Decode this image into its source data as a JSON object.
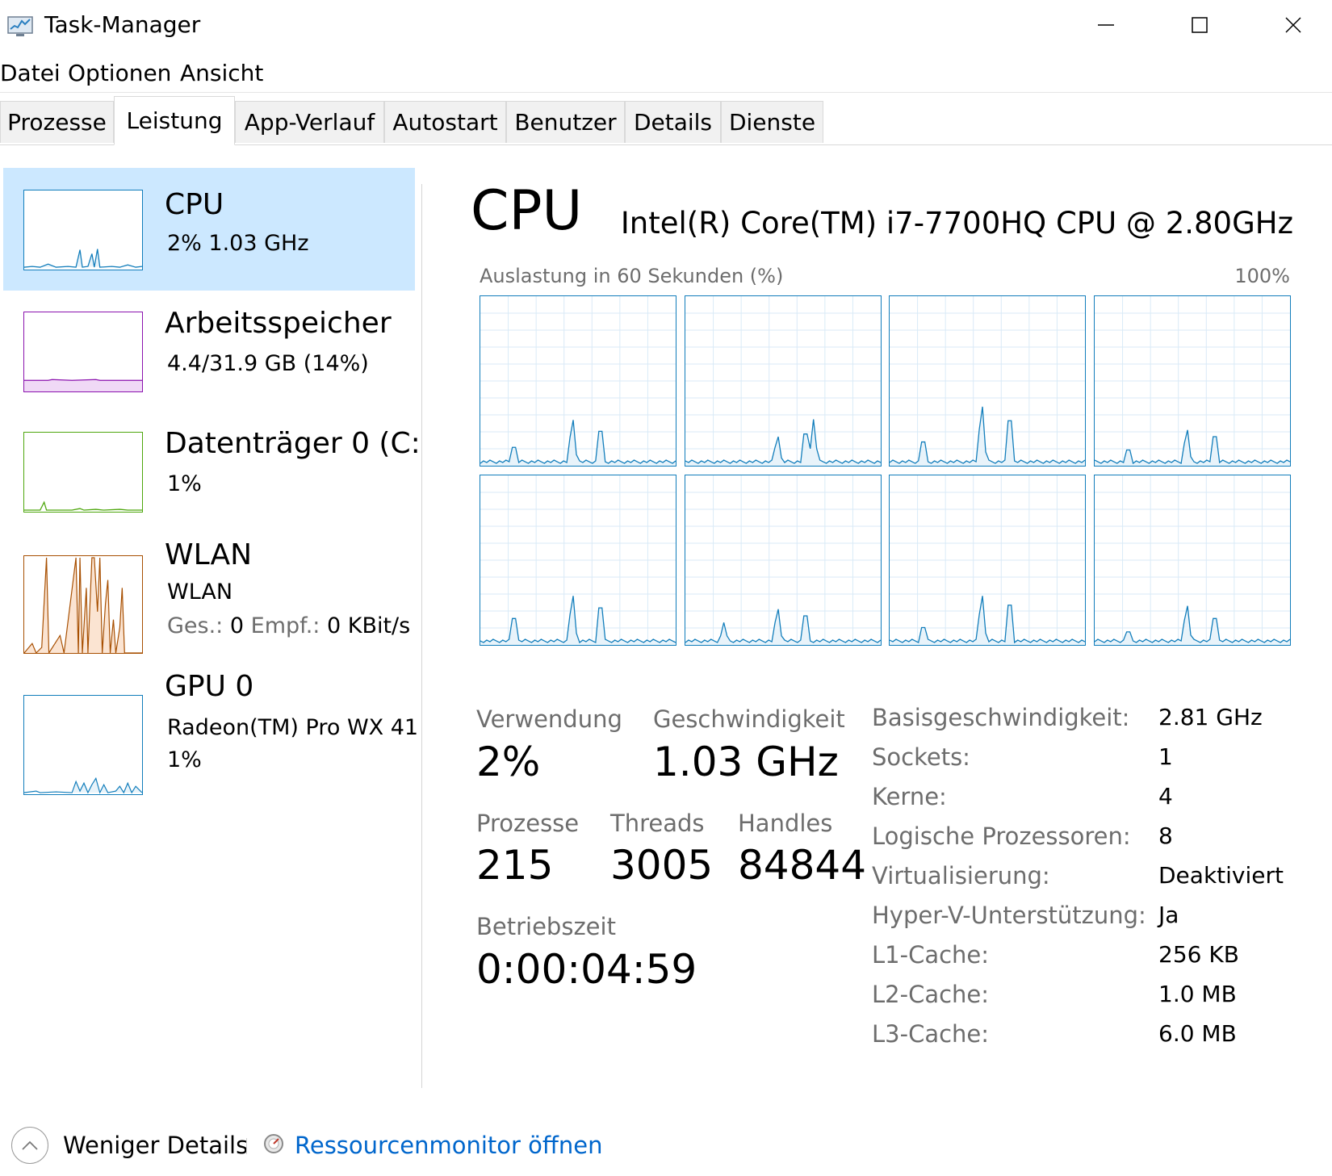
{
  "window": {
    "title": "Task-Manager",
    "icon": "task-manager-icon"
  },
  "controls": {
    "minimize": "minimize-icon",
    "maximize": "maximize-icon",
    "close": "close-icon"
  },
  "menu": {
    "items": [
      "Datei",
      "Optionen",
      "Ansicht"
    ]
  },
  "tabs": [
    {
      "label": "Prozesse"
    },
    {
      "label": "Leistung",
      "active": true
    },
    {
      "label": "App-Verlauf"
    },
    {
      "label": "Autostart"
    },
    {
      "label": "Benutzer"
    },
    {
      "label": "Details"
    },
    {
      "label": "Dienste"
    }
  ],
  "sidebar": {
    "items": [
      {
        "title": "CPU",
        "sub1": "2%  1.03 GHz",
        "color": "#117dbb",
        "selected": true
      },
      {
        "title": "Arbeitsspeicher",
        "sub1": "4.4/31.9 GB (14%)",
        "color": "#8b12ae"
      },
      {
        "title": "Datenträger 0 (C:",
        "sub1": "1%",
        "color": "#4da60c"
      },
      {
        "title": "WLAN",
        "sub1": "WLAN",
        "sub2_a": "Ges.:",
        "sub2_b": "0",
        "sub2_c": "Empf.:",
        "sub2_d": "0 KBit/s",
        "color": "#a74f01"
      },
      {
        "title": "GPU 0",
        "sub1": "Radeon(TM) Pro WX 41",
        "sub2": "1%",
        "color": "#117dbb"
      }
    ]
  },
  "main": {
    "title": "CPU",
    "cpu_name": "Intel(R) Core(TM) i7-7700HQ CPU @ 2.80GHz",
    "graph_label": "Auslastung in 60 Sekunden (%)",
    "graph_max": "100%",
    "accent": "#117dbb",
    "stats": {
      "usage_label": "Verwendung",
      "usage_value": "2%",
      "speed_label": "Geschwindigkeit",
      "speed_value": "1.03 GHz",
      "processes_label": "Prozesse",
      "processes_value": "215",
      "threads_label": "Threads",
      "threads_value": "3005",
      "handles_label": "Handles",
      "handles_value": "84844",
      "uptime_label": "Betriebszeit",
      "uptime_value": "0:00:04:59"
    },
    "info": [
      {
        "label": "Basisgeschwindigkeit:",
        "value": "2.81 GHz"
      },
      {
        "label": "Sockets:",
        "value": "1"
      },
      {
        "label": "Kerne:",
        "value": "4"
      },
      {
        "label": "Logische Prozessoren:",
        "value": "8"
      },
      {
        "label": "Virtualisierung:",
        "value": "Deaktiviert"
      },
      {
        "label": "Hyper-V-Unterstützung:",
        "value": "Ja"
      },
      {
        "label": "L1-Cache:",
        "value": "256 KB"
      },
      {
        "label": "L2-Cache:",
        "value": "1.0 MB"
      },
      {
        "label": "L3-Cache:",
        "value": "6.0 MB"
      }
    ]
  },
  "footer": {
    "less_details": "Weniger Details",
    "resource_monitor": "Ressourcenmonitor öffnen"
  }
}
